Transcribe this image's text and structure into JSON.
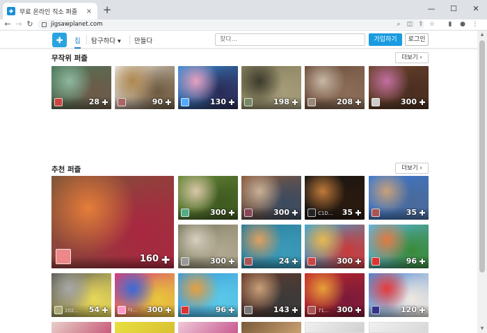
{
  "browser": {
    "tab_title": "무료 온라인 직소 퍼즐",
    "tab_close": "×",
    "new_tab": "+",
    "url": "jigsawplanet.com",
    "win_min": "—",
    "win_max": "☐",
    "win_close": "✕",
    "back": "←",
    "forward": "→",
    "reload": "↻"
  },
  "header": {
    "logo_glyph": "✚",
    "nav_home": "집",
    "nav_explore": "탐구하다 ▾",
    "nav_create": "만들다",
    "search_placeholder": "찾다...",
    "join": "가입하기",
    "login": "로그인"
  },
  "random": {
    "title": "무작위 퍼즐",
    "more": "더보기 ›",
    "tiles": [
      {
        "count": "28",
        "colors": [
          "#4a7a5a",
          "#8fb8a0",
          "#6d5a48"
        ],
        "avatar": "#c44"
      },
      {
        "count": "90",
        "colors": [
          "#e9e2d6",
          "#b08850",
          "#6e5a40"
        ],
        "avatar": "#a66"
      },
      {
        "count": "130",
        "colors": [
          "#3a8ed4",
          "#e7a0c0",
          "#2a2a55"
        ],
        "avatar": "#5af"
      },
      {
        "count": "198",
        "colors": [
          "#7f7a58",
          "#3c3a2c",
          "#a59b78"
        ],
        "avatar": "#786"
      },
      {
        "count": "208",
        "colors": [
          "#6b4b3a",
          "#c7b8a4",
          "#8a6c58"
        ],
        "avatar": "#987"
      },
      {
        "count": "300",
        "colors": [
          "#6e4630",
          "#c36fa0",
          "#4b2e20"
        ],
        "avatar": "#ccc"
      }
    ]
  },
  "recommended": {
    "title": "추천 퍼즐",
    "more": "더보기 ›",
    "big": {
      "count": "160",
      "uname": "",
      "colors": [
        "#7d5638",
        "#e57d3a",
        "#a82740"
      ],
      "avatar": "#e88"
    },
    "tiles": [
      {
        "count": "300",
        "uname": "",
        "colors": [
          "#6a8a3a",
          "#d9c7a8",
          "#3e5a20"
        ],
        "avatar": "#5a8"
      },
      {
        "count": "300",
        "uname": "",
        "colors": [
          "#8a5a3a",
          "#c8b098",
          "#3a4a60"
        ],
        "avatar": "#845"
      },
      {
        "count": "35",
        "uname": "C1D...",
        "colors": [
          "#141414",
          "#c07a3a",
          "#2a1a10"
        ],
        "avatar": "#222"
      },
      {
        "count": "35",
        "uname": "",
        "colors": [
          "#3a7ad4",
          "#c9a078",
          "#4a6a9a"
        ],
        "avatar": "#a55"
      },
      {
        "count": "300",
        "uname": "",
        "colors": [
          "#7a7a60",
          "#d8cfc0",
          "#b0a890"
        ],
        "avatar": "#999"
      },
      {
        "count": "24",
        "uname": "",
        "colors": [
          "#2a7a98",
          "#e0a060",
          "#3a9ab8"
        ],
        "avatar": "#a55"
      },
      {
        "count": "300",
        "uname": "",
        "colors": [
          "#3aa8d8",
          "#e8b850",
          "#c83a3a"
        ],
        "avatar": "#c44"
      },
      {
        "count": "96",
        "uname": "",
        "colors": [
          "#5ab8e8",
          "#e07a40",
          "#3a8a3a"
        ],
        "avatar": "#d33"
      },
      {
        "count": "54",
        "uname": "202...",
        "colors": [
          "#5a5a5a",
          "#a8a8a8",
          "#e8d858"
        ],
        "avatar": "#aa7"
      },
      {
        "count": "300",
        "uname": "다...",
        "colors": [
          "#d83a7a",
          "#3a6ad8",
          "#e8c83a"
        ],
        "avatar": "#f9c"
      },
      {
        "count": "96",
        "uname": "",
        "colors": [
          "#3a9ad8",
          "#e8a040",
          "#5ac8e8"
        ],
        "avatar": "#d33"
      },
      {
        "count": "143",
        "uname": "",
        "colors": [
          "#6a3a2a",
          "#c8a07a",
          "#3a3a3a"
        ],
        "avatar": "#777"
      },
      {
        "count": "300",
        "uname": "71...",
        "colors": [
          "#c82a2a",
          "#e8a03a",
          "#7a1a3a"
        ],
        "avatar": "#a55"
      },
      {
        "count": "120",
        "uname": "",
        "colors": [
          "#4a8ad8",
          "#e83a3a",
          "#f0e8e0"
        ],
        "avatar": "#338"
      }
    ]
  },
  "bottom_row_colors": [
    [
      "#e8d0c8",
      "#c85a7a"
    ],
    [
      "#e8e040",
      "#d8c030"
    ],
    [
      "#f0c8d8",
      "#c85a90"
    ],
    [
      "#7a5a3a",
      "#c8a070"
    ],
    [
      "#f0f0f0",
      "#d0d0d0"
    ],
    [
      "#f0f0f0",
      "#d8d8d8"
    ],
    [
      "#a83a3a",
      "#7a2a2a"
    ]
  ]
}
